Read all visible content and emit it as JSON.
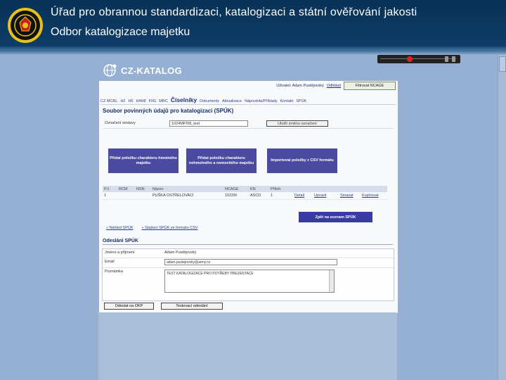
{
  "slide": {
    "title_line1": "Úřad pro obrannou standardizaci, katalogizaci a státní ověřování jakosti",
    "title_line2": "Odbor katalogizace majetku"
  },
  "logo": {
    "text": "CZ-KATALOG"
  },
  "app": {
    "userbar": {
      "label": "Uživatel: Adam Pustějovský",
      "logout": "Odhlásit",
      "filter_button": "Filtrovat NCAGE"
    },
    "nav": {
      "items": [
        "CZ MCRL",
        "H2",
        "H6",
        "H4H8",
        "FIIG",
        "MRC",
        "Číselníky",
        "Dokumenty",
        "Aktualizace",
        "Nápověda/Příklady",
        "Kontakt",
        "SPÚK"
      ],
      "active": "Číselníky"
    },
    "page_title": "Soubor povinných údajů pro katalogizaci (SPÚK)",
    "set_label": "Označení sestavy",
    "set_value": "1024MP/08_test",
    "set_button": "Uložit změnu označení",
    "actions": [
      "Přidat položku charakteru hmotného majetku",
      "Přidat položku charakteru nehmotného a nemovitého majetku",
      "Importovat položky z CSV formátu"
    ],
    "grid": {
      "headers": [
        "P.č.",
        "RCM",
        "NSN",
        "Název",
        "NCAGE",
        "KN",
        "Příloh",
        "",
        "",
        "",
        ""
      ],
      "rows": [
        [
          "1",
          "",
          "",
          "PUŠKA OSTŘELOVACÍ",
          "1022M",
          "ASCD",
          "1",
          "Detail",
          "Upravit",
          "Smazat",
          "Kopírovat"
        ]
      ]
    },
    "back_button": "Zpět na seznam SPÚK",
    "links": [
      "» Náhled SPÚK",
      "» Stažení SPÚK ve formátu CSV"
    ],
    "send": {
      "title": "Odeslání SPÚK",
      "name_label": "Jméno a příjmení",
      "name_value": "Adam Pustějovský",
      "email_label": "Email",
      "email_value": "adam.pustejovsky@army.cz",
      "note_label": "Poznámka",
      "note_value": "TEST KATALOGIZACE PRO POTŘEBY PREZENTACE",
      "send_button": "Odeslat na OKP",
      "test_button": "Testovací odeslání"
    }
  },
  "colors": {
    "banner": "#083257",
    "background": "#95b0d2",
    "action_box": "#4a4aa0"
  }
}
